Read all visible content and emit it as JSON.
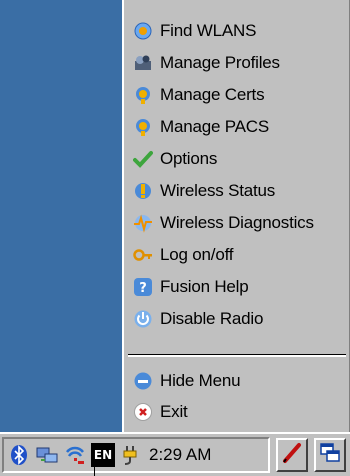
{
  "menu": {
    "items": [
      {
        "label": "Find WLANS",
        "icon": "find-wlans-icon"
      },
      {
        "label": "Manage Profiles",
        "icon": "manage-profiles-icon"
      },
      {
        "label": "Manage Certs",
        "icon": "manage-certs-icon"
      },
      {
        "label": "Manage PACS",
        "icon": "manage-pacs-icon"
      },
      {
        "label": "Options",
        "icon": "options-check-icon"
      },
      {
        "label": "Wireless Status",
        "icon": "wireless-status-icon"
      },
      {
        "label": "Wireless Diagnostics",
        "icon": "wireless-diagnostics-icon"
      },
      {
        "label": "Log on/off",
        "icon": "key-icon"
      },
      {
        "label": "Fusion Help",
        "icon": "help-icon"
      },
      {
        "label": "Disable Radio",
        "icon": "power-icon"
      },
      {
        "label": "Hide Menu",
        "icon": "hide-menu-icon"
      },
      {
        "label": "Exit",
        "icon": "exit-icon"
      }
    ]
  },
  "taskbar": {
    "input_language": "EN",
    "clock": "2:29 AM",
    "icons": [
      "bluetooth-icon",
      "network-icon",
      "wireless-tray-icon",
      "power-plug-icon",
      "pen-icon",
      "windows-switch-icon"
    ]
  },
  "colors": {
    "desktop": "#3a6ea5",
    "menu_background": "#c0c0c0",
    "icon_blue": "#4a8ad8",
    "icon_orange": "#f0a000",
    "check_green": "#3da53d"
  }
}
